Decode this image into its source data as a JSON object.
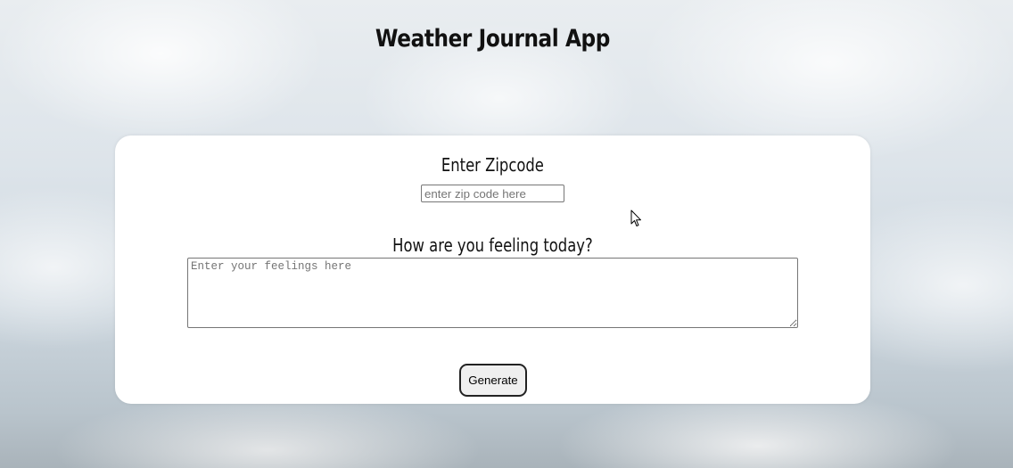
{
  "app": {
    "title": "Weather Journal App"
  },
  "zipcode": {
    "heading": "Enter Zipcode",
    "placeholder": "enter zip code here",
    "value": ""
  },
  "feelings": {
    "heading": "How are you feeling today?",
    "placeholder": "Enter your feelings here",
    "value": ""
  },
  "actions": {
    "generate_label": "Generate"
  },
  "colors": {
    "card_background": "#ffffff",
    "button_background": "#efefef",
    "button_border": "#222222",
    "text": "#111111"
  },
  "icons": {
    "cursor": "mouse-pointer-icon"
  }
}
